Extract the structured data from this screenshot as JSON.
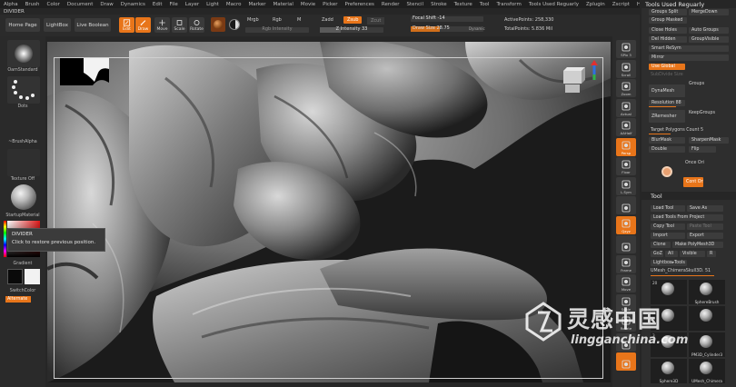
{
  "menu": [
    "Alpha",
    "Brush",
    "Color",
    "Document",
    "Draw",
    "Dynamics",
    "Edit",
    "File",
    "Layer",
    "Light",
    "Macro",
    "Marker",
    "Material",
    "Movie",
    "Picker",
    "Preferences",
    "Render",
    "Stencil",
    "Stroke",
    "Texture",
    "Tool",
    "Transform",
    "Tools Used Reguarly",
    "Zplugin",
    "Zscript",
    "Help"
  ],
  "divider": "DIVIDER",
  "shelf": {
    "home_page": "Home Page",
    "lightbox": "LightBox",
    "live_boolean": "Live Boolean",
    "tools": [
      {
        "label": "Edit",
        "icon": "edit-icon",
        "active": true
      },
      {
        "label": "Draw",
        "icon": "draw-icon",
        "active": true
      },
      {
        "label": "Move",
        "icon": "move-icon",
        "active": false
      },
      {
        "label": "Scale",
        "icon": "scale-icon",
        "active": false
      },
      {
        "label": "Rotate",
        "icon": "rotate-icon",
        "active": false
      }
    ],
    "mrgb": "Mrgb",
    "rgb": "Rgb",
    "m": "M",
    "rgb_intensity": "Rgb Intensity",
    "zadd": "Zadd",
    "zsub": "Zsub",
    "zcut": "Zcut",
    "z_intensity": "Z Intensity 33",
    "focal_shift": "Focal Shift -14",
    "draw_size": "Draw Size 28.75",
    "dynamic": "Dynamic",
    "active_points": "ActivePoints: 258,330",
    "total_points": "TotalPoints: 5.836 Mil"
  },
  "left": {
    "alpha": "OamStandard",
    "stroke": "Dots",
    "brush_alpha": "~BrushAlpha",
    "texture": "Texture Off",
    "material": "StartupMaterial",
    "gradient": "Gradient",
    "switch_color": "SwitchColor",
    "alternate": "Alternate"
  },
  "tooltip": {
    "title": "DIVIDER",
    "text": "Click to restore previous position."
  },
  "right_shelf": [
    {
      "label": "SPix 3",
      "icon": "bpr-icon"
    },
    {
      "label": "Scroll",
      "icon": "scroll-icon"
    },
    {
      "label": "Zoom",
      "icon": "zoom-icon"
    },
    {
      "label": "Actual",
      "icon": "actual-icon"
    },
    {
      "label": "AAHalf",
      "icon": "aahalf-icon"
    },
    {
      "label": "Persp",
      "icon": "persp-icon"
    },
    {
      "label": "Floor",
      "icon": "floor-icon"
    },
    {
      "label": "L.Sym",
      "icon": "lsym-icon"
    },
    {
      "label": "",
      "icon": "lock-icon"
    },
    {
      "label": "Qxyz",
      "icon": "xyz-icon"
    },
    {
      "label": "",
      "icon": "rotate-view-icon"
    },
    {
      "label": "Frame",
      "icon": "frame-icon"
    },
    {
      "label": "Move",
      "icon": "move-view-icon"
    },
    {
      "label": "Scale",
      "icon": "scale-view-icon"
    },
    {
      "label": "Rotate",
      "icon": "rotate-view2-icon"
    },
    {
      "label": "",
      "icon": "transp-icon"
    },
    {
      "label": "",
      "icon": "ghost-icon"
    }
  ],
  "panel": {
    "title": "Tools Used Reguarly",
    "groups_split": "Groups Split",
    "merge_down": "MergeDown",
    "group_masked": "Group Masked",
    "close_holes": "Close Holes",
    "auto_groups": "Auto Groups",
    "del_hidden": "Del Hidden",
    "group_visible": "GroupVisible",
    "smart_resym": "Smart ReSym",
    "mirror": "Mirror",
    "use_global": "Use Global",
    "subdivide_size": "SubDivide Size",
    "dynamesh": "DynaMesh",
    "groups": "Groups",
    "resolution": "Resolution 88",
    "zremesher": "ZRemesher",
    "keep_groups": "KeepGroups",
    "target_polygons": "Target Polygons Count 5",
    "blur_mask": "BlurMask",
    "sharpen_mask": "SharpenMask",
    "double": "Double",
    "flip": "Flip",
    "once_ori": "Once Ori",
    "cont_ori": "Cont Ori",
    "tool_title": "Tool",
    "load_tool": "Load Tool",
    "save_as": "Save As",
    "load_from_project": "Load Tools From Project",
    "copy_tool": "Copy Tool",
    "paste_tool": "Paste Tool",
    "import": "Import",
    "export": "Export",
    "clone": "Clone",
    "make_polymesh": "Make PolyMesh3D",
    "goz": "GoZ",
    "all": "All",
    "visible": "Visible",
    "r": "R",
    "lightbox_tools": "Lightbox▸Tools",
    "current_tool": "UMesh_ChimeraSkull3D. 51",
    "thumbs": [
      {
        "label": "",
        "count": "20"
      },
      {
        "label": "SphereBrush",
        "count": ""
      },
      {
        "label": "",
        "count": ""
      },
      {
        "label": "",
        "count": ""
      },
      {
        "label": "",
        "count": "3"
      },
      {
        "label": "PM3D_Cylinder3",
        "count": ""
      },
      {
        "label": "Sphere3D",
        "count": ""
      },
      {
        "label": "UMesh_Chimera",
        "count": ""
      }
    ]
  },
  "watermark": {
    "cn": "灵感中国",
    "url": "lingganchina.com"
  },
  "colors": {
    "accent": "#e8751a",
    "panel": "#2e2e2e",
    "canvas": "#1b1b1b"
  }
}
